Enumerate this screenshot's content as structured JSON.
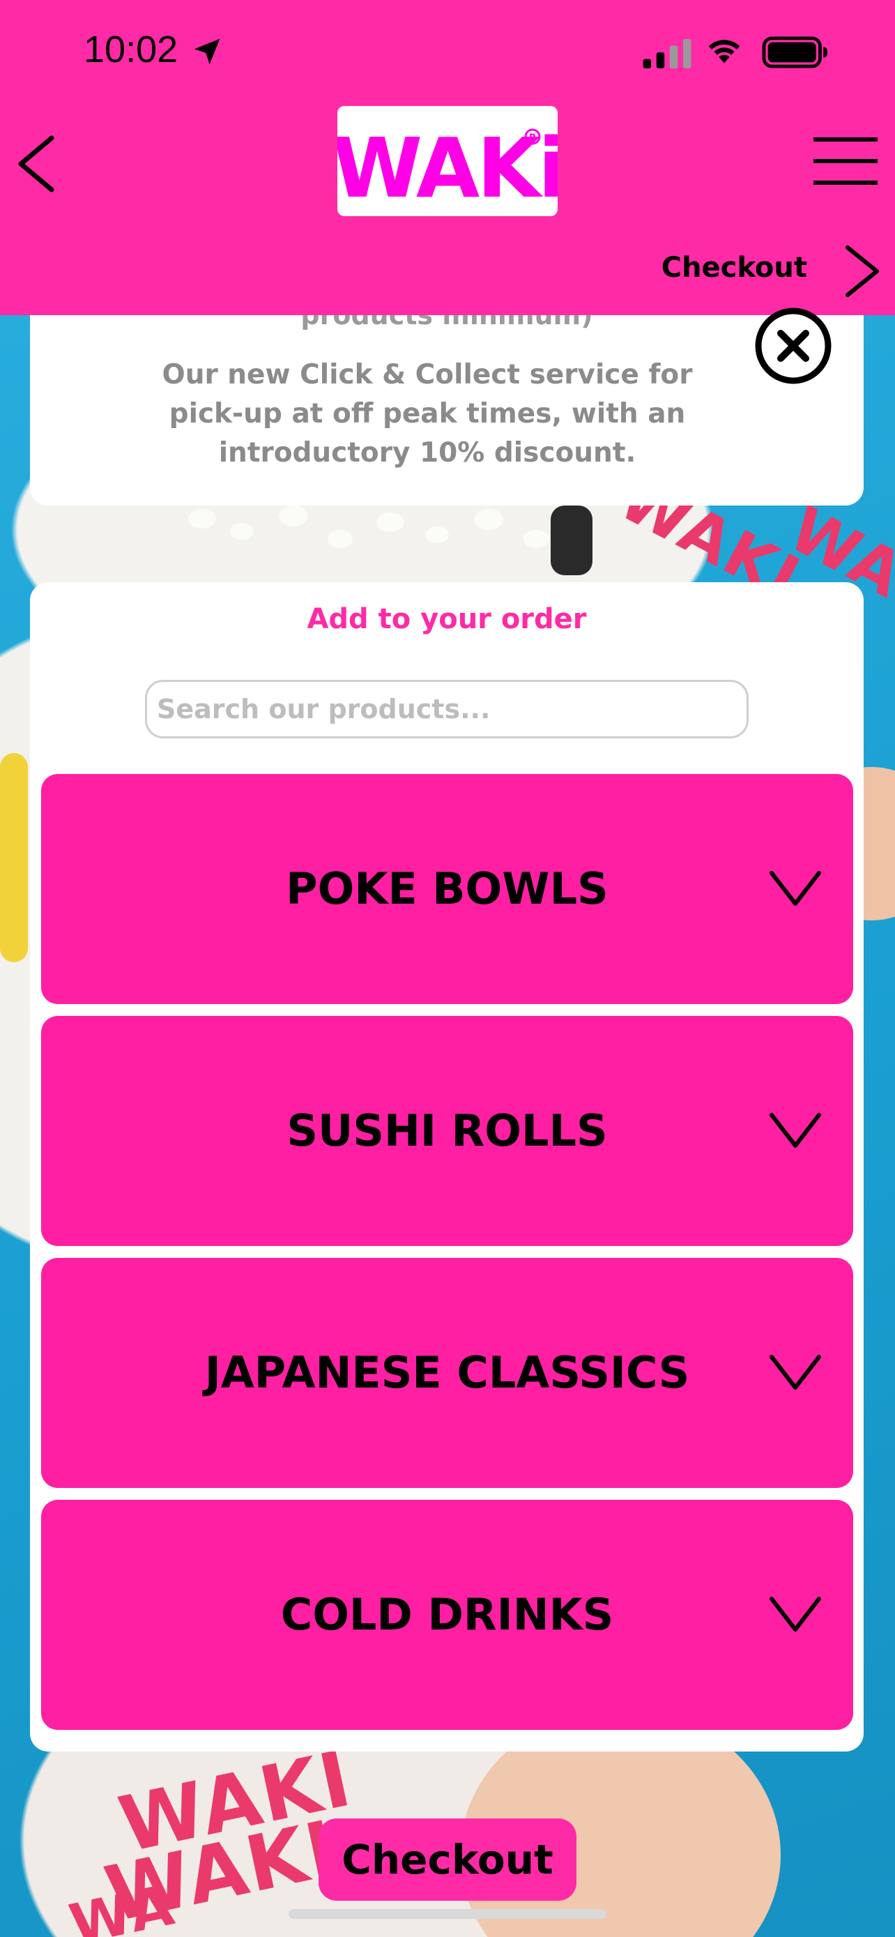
{
  "status_bar": {
    "time": "10:02",
    "icons": [
      "location-arrow-icon",
      "cellular-signal-icon",
      "wifi-icon",
      "battery-icon"
    ]
  },
  "header": {
    "logo_text": "WAKi",
    "back_icon": "chevron-left-icon",
    "menu_icon": "hamburger-menu-icon"
  },
  "subheader": {
    "checkout_label": "Checkout",
    "chevron_icon": "chevron-right-icon"
  },
  "info_banner": {
    "cutoff_text": "products minimum)",
    "description": "Our new Click & Collect service for pick-up at off peak times, with an introductory 10% discount.",
    "close_icon": "close-circle-icon"
  },
  "order": {
    "title": "Add to your order",
    "search_placeholder": "Search our products...",
    "categories": [
      {
        "label": "POKE BOWLS"
      },
      {
        "label": "SUSHI ROLLS"
      },
      {
        "label": "JAPANESE CLASSICS"
      },
      {
        "label": "COLD DRINKS"
      }
    ]
  },
  "footer": {
    "checkout_button": "Checkout"
  },
  "colors": {
    "brand_pink": "#ff2aa6",
    "category_pink": "#ff1fa2",
    "background_blue": "#22a7d6",
    "text_grey": "#8b8b8b"
  }
}
